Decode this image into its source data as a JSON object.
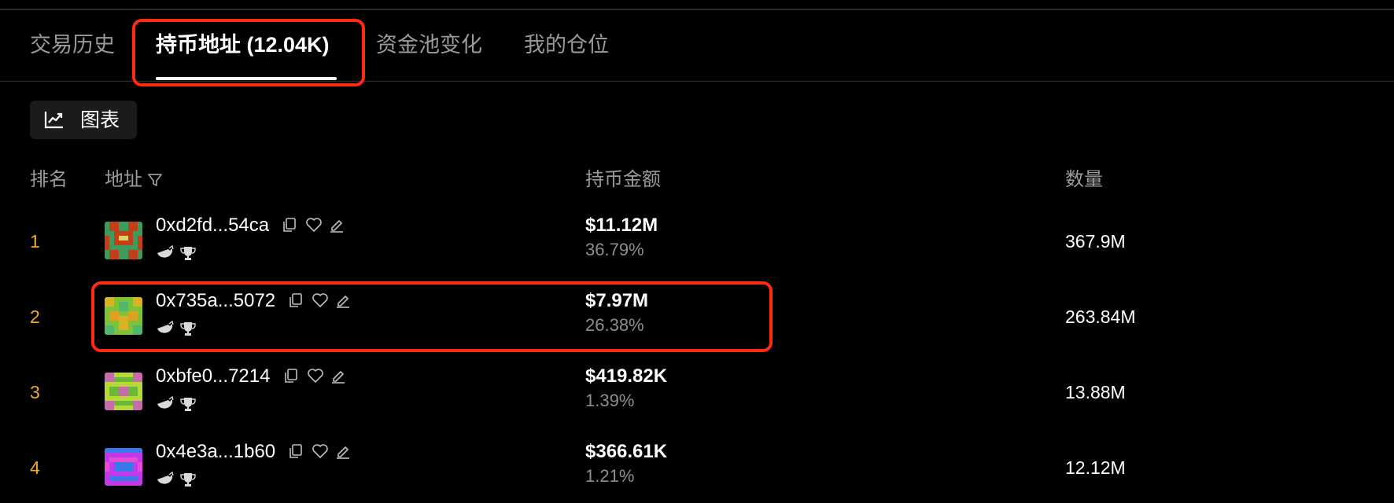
{
  "tabs": [
    {
      "label": "交易历史"
    },
    {
      "label": "持币地址 (12.04K)"
    },
    {
      "label": "资金池变化"
    },
    {
      "label": "我的仓位"
    }
  ],
  "chart_button": {
    "label": "图表",
    "icon": "chart-line-icon"
  },
  "table": {
    "headers": {
      "rank": "排名",
      "address": "地址",
      "amount": "持币金额",
      "quantity": "数量"
    },
    "rows": [
      {
        "rank": "1",
        "address": "0xd2fd...54ca",
        "amount": "$11.12M",
        "percent": "36.79%",
        "quantity": "367.9M"
      },
      {
        "rank": "2",
        "address": "0x735a...5072",
        "amount": "$7.97M",
        "percent": "26.38%",
        "quantity": "263.84M"
      },
      {
        "rank": "3",
        "address": "0xbfe0...7214",
        "amount": "$419.82K",
        "percent": "1.39%",
        "quantity": "13.88M"
      },
      {
        "rank": "4",
        "address": "0x4e3a...1b60",
        "amount": "$366.61K",
        "percent": "1.21%",
        "quantity": "12.12M"
      }
    ]
  },
  "colors": {
    "background": "#000000",
    "rank": "#f0a92a",
    "muted": "#9a9a9a",
    "highlight": "#ff2a12"
  }
}
